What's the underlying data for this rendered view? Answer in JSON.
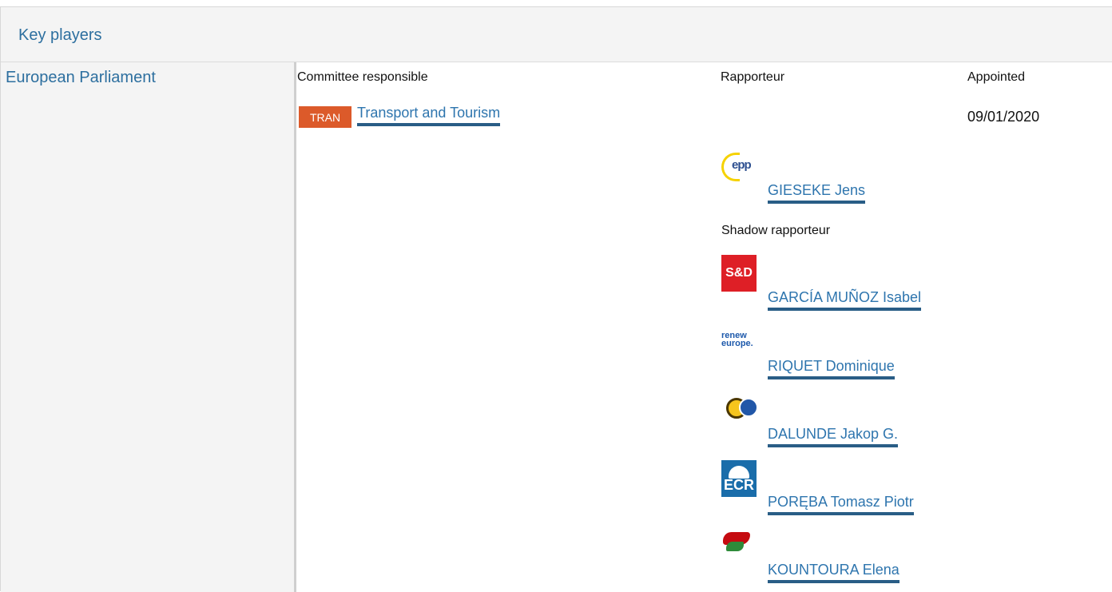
{
  "section": {
    "title": "Key players"
  },
  "institution": {
    "name": "European Parliament"
  },
  "columns": {
    "committee_responsible": "Committee responsible",
    "rapporteur": "Rapporteur",
    "appointed": "Appointed"
  },
  "committee": {
    "code": "TRAN",
    "name": "Transport and Tourism",
    "appointed": "09/01/2020",
    "code_color": "#dc5a2a"
  },
  "rapporteur": {
    "name": "GIESEKE Jens",
    "group_logo": "epp-logo"
  },
  "shadow": {
    "heading": "Shadow rapporteur",
    "members": [
      {
        "name": "GARCÍA MUÑOZ Isabel",
        "group_logo": "sd-logo",
        "logo_text": "S&D"
      },
      {
        "name": "RIQUET Dominique",
        "group_logo": "renew-logo",
        "logo_text_1": "renew",
        "logo_text_2": "europe."
      },
      {
        "name": "DALUNDE Jakop G.",
        "group_logo": "greens-efa-logo"
      },
      {
        "name": "PORĘBA Tomasz Piotr",
        "group_logo": "ecr-logo",
        "logo_text": "ECR"
      },
      {
        "name": "KOUNTOURA Elena",
        "group_logo": "gue-ngl-logo"
      }
    ]
  },
  "epp_logo_text": "epp",
  "colors": {
    "link": "#2e75ae",
    "link_underline": "#295d86",
    "header_bg": "#f4f4f4"
  }
}
